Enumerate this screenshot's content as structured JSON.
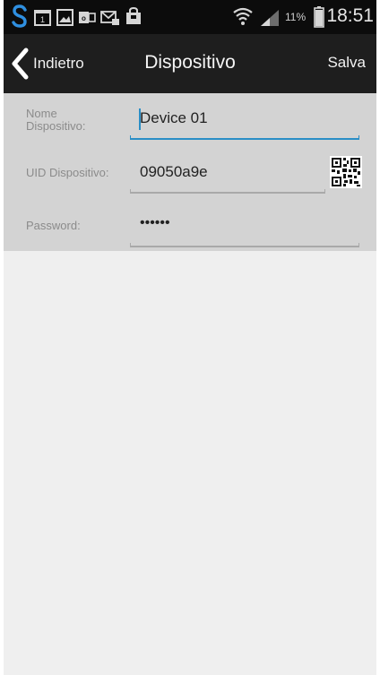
{
  "status_bar": {
    "battery_percent": "11%",
    "time": "18:51"
  },
  "nav": {
    "back_label": "Indietro",
    "title": "Dispositivo",
    "save_label": "Salva"
  },
  "form": {
    "name_label_line1": "Nome",
    "name_label_line2": "Dispositivo:",
    "name_value": "Device 01",
    "uid_label": "UID Dispositivo:",
    "uid_value": "09050a9e",
    "password_label": "Password:",
    "password_value": "••••••"
  },
  "colors": {
    "accent": "#2a8ec6",
    "nav_background": "#1e1e1e",
    "form_background": "#d3d3d3",
    "page_background": "#efefef"
  },
  "icons": [
    "s-app-icon",
    "calendar-icon",
    "gallery-icon",
    "outlook-icon",
    "email-icon",
    "shopping-bag-icon",
    "wifi-icon",
    "signal-icon",
    "battery-icon",
    "back-chevron-icon",
    "qr-code-icon"
  ]
}
